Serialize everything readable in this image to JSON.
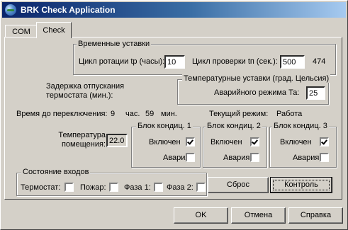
{
  "window": {
    "title": "BRK Check Application",
    "icon": "globe-icon"
  },
  "tabs": [
    {
      "label": "COM"
    },
    {
      "label": "Check"
    }
  ],
  "time_settings": {
    "title": "Временные уставки",
    "rotation_label": "Цикл ротации tр (часы):",
    "rotation_value": "10",
    "check_label": "Цикл проверки tп (сек.):",
    "check_value": "500",
    "check_current": "474"
  },
  "thermostat_delay": {
    "label": "Задержка отпускания термостата (мин.):"
  },
  "temp_settings": {
    "title": "Температурные уставки (град. Цельсия)",
    "alarm_label": "Аварийного режима Та:",
    "alarm_value": "25"
  },
  "switch_time": {
    "label": "Время до переключения:",
    "hours": "9",
    "hours_unit": "час.",
    "minutes": "59",
    "minutes_unit": "мин."
  },
  "mode": {
    "label": "Текущий режим:",
    "value": "Работа"
  },
  "room_temp": {
    "label": "Температура помещения:",
    "value": "22.0"
  },
  "units": [
    {
      "title": "Блок кондиц. 1",
      "enabled_label": "Включен",
      "enabled": true,
      "alarm_label": "Авария:",
      "alarm": false
    },
    {
      "title": "Блок кондиц. 2",
      "enabled_label": "Включен",
      "enabled": true,
      "alarm_label": "Авария:",
      "alarm": false
    },
    {
      "title": "Блок кондиц. 3",
      "enabled_label": "Включен",
      "enabled": true,
      "alarm_label": "Авария:",
      "alarm": false
    }
  ],
  "inputs_state": {
    "title": "Состояние входов",
    "items": [
      {
        "label": "Термостат:",
        "checked": false
      },
      {
        "label": "Пожар:",
        "checked": false
      },
      {
        "label": "Фаза 1:",
        "checked": false
      },
      {
        "label": "Фаза 2:",
        "checked": false
      }
    ]
  },
  "buttons": {
    "reset": "Сброс",
    "control": "Контроль",
    "ok": "OK",
    "cancel": "Отмена",
    "help": "Справка"
  }
}
